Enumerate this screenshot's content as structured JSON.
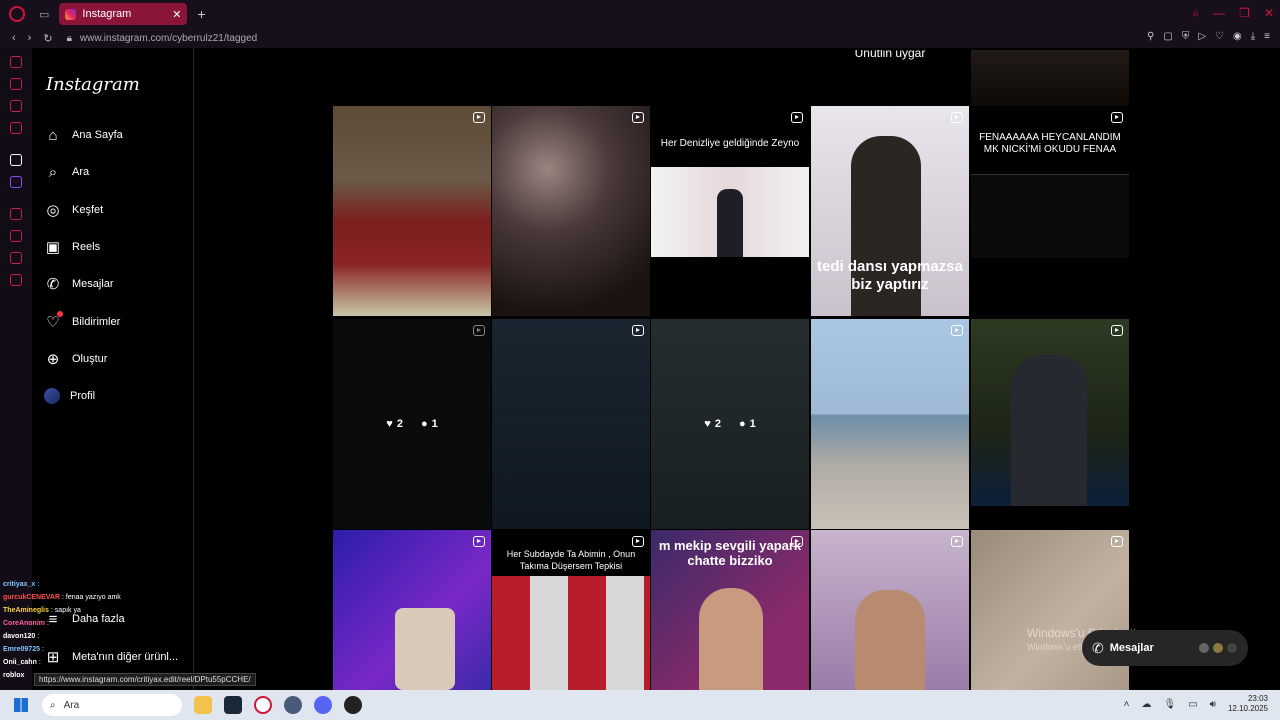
{
  "browser": {
    "tab_title": "Instagram",
    "tab_close": "✕",
    "new_tab": "+",
    "url": "www.instagram.com/cyberrulz21/tagged"
  },
  "sidebar": {
    "logo": "Instagram",
    "items": [
      {
        "label": "Ana Sayfa",
        "icon": "home-icon"
      },
      {
        "label": "Ara",
        "icon": "search-icon"
      },
      {
        "label": "Keşfet",
        "icon": "compass-icon"
      },
      {
        "label": "Reels",
        "icon": "reels-icon"
      },
      {
        "label": "Mesajlar",
        "icon": "messenger-icon"
      },
      {
        "label": "Bildirimler",
        "icon": "heart-icon"
      },
      {
        "label": "Oluştur",
        "icon": "plus-icon"
      },
      {
        "label": "Profil",
        "icon": "avatar"
      }
    ],
    "more": "Daha fazla",
    "meta": "Meta'nın diğer ürünl..."
  },
  "top_partial_caption": "Unutlin uygar",
  "grid": {
    "captions": {
      "t3": "Her Denizliye geldiğinde Zeyno",
      "t4": "tedi dansı yapmazsa biz yaptırız",
      "t5": "FENAAAAAA HEYCANLANDIM MK NICKİ'Mİ OKUDU FENAA",
      "t12": "Her Subdayde Ta Abimin , Onun Takıma Düşersem Tepkisi",
      "t13": "m mekip sevgili yapark chatte bizziko"
    },
    "hover1": {
      "likes": "2",
      "comments": "1"
    },
    "hover2": {
      "likes": "2",
      "comments": "1"
    }
  },
  "chat": [
    {
      "user": "critiyax_x",
      "msg": ":",
      "color": "#7ec8ff"
    },
    {
      "user": "gurcukCENEVAR",
      "msg": ": fenaa yazıyo amk",
      "color": "#ff4d4d"
    },
    {
      "user": "TheAmineglis",
      "msg": ": sapık ya",
      "color": "#ffd23f"
    },
    {
      "user": "CoreAnonim",
      "msg": ":",
      "color": "#ff5fa2"
    },
    {
      "user": "davon120",
      "msg": ":",
      "color": "#ffffff"
    },
    {
      "user": "Emre09725",
      "msg": ":",
      "color": "#7ec8ff"
    },
    {
      "user": "Onii_cahn",
      "msg": ":",
      "color": "#ffffff"
    },
    {
      "user": "roblox",
      "msg": "",
      "color": "#ffffff"
    }
  ],
  "status_url": "https://www.instagram.com/critiyax.edit/reel/DPtu55pCCHE/",
  "watermark": {
    "title": "Windows'u Etkinleştir",
    "sub": "Windows'u etkinleştirmek için Ayarlar'a gidin."
  },
  "messages_pill": "Mesajlar",
  "taskbar": {
    "search": "Ara",
    "time": "23:03",
    "date": "12.10.2025"
  },
  "colors": {
    "accent": "#d2143a",
    "tab": "#8b1538",
    "bg": "#000000"
  }
}
